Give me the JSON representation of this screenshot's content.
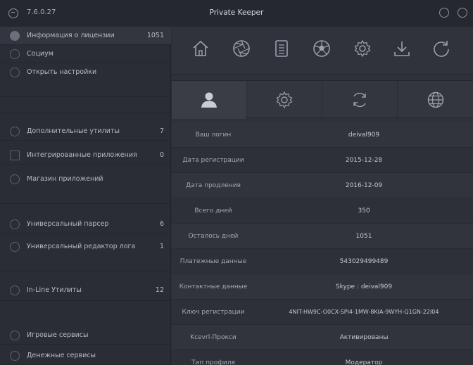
{
  "window": {
    "version": "7.6.0.27",
    "title": "Private Keeper"
  },
  "sidebar": {
    "items": [
      {
        "label": "Информация о лицензии",
        "count": "1051"
      },
      {
        "label": "Социум",
        "count": ""
      },
      {
        "label": "Открыть настройки",
        "count": ""
      },
      {
        "label": "Дополнительные утилиты",
        "count": "7"
      },
      {
        "label": "Интегрированные приложения",
        "count": "0"
      },
      {
        "label": "Магазин приложений",
        "count": ""
      },
      {
        "label": "Универсальный парсер",
        "count": "6"
      },
      {
        "label": "Универсальный редактор лога",
        "count": "1"
      },
      {
        "label": "In-Line Утилиты",
        "count": "12"
      },
      {
        "label": "Игровые сервисы",
        "count": ""
      },
      {
        "label": "Денежные сервисы",
        "count": ""
      }
    ]
  },
  "toolbar": {
    "icons": [
      "home-icon",
      "aperture-icon",
      "notebook-icon",
      "ball-icon",
      "gear-icon",
      "download-icon",
      "refresh-icon"
    ]
  },
  "tabs": {
    "icons": [
      "user-icon",
      "gear-icon",
      "sync-icon",
      "globe-icon"
    ]
  },
  "info": {
    "rows": [
      {
        "key": "Ваш логин",
        "value": "deival909"
      },
      {
        "key": "Дата регистрации",
        "value": "2015-12-28"
      },
      {
        "key": "Дата продления",
        "value": "2016-12-09"
      },
      {
        "key": "Всего дней",
        "value": "350"
      },
      {
        "key": "Осталось дней",
        "value": "1051"
      },
      {
        "key": "Платежные данные",
        "value": "543029499489"
      },
      {
        "key": "Контактные данные",
        "value": "Skype : deival909"
      },
      {
        "key": "Ключ регистрации",
        "value": "4NIT-HW9C-O0CX-SPI4-1MW-8KIA-9WYH-Q1GN-22I04"
      },
      {
        "key": "Kcevrl-Прокси",
        "value": "Активированы"
      },
      {
        "key": "Тип профиля",
        "value": "Модератор"
      }
    ]
  },
  "colors": {
    "background": "#2b2e36",
    "sidebar": "#2a2d35",
    "titlebar": "#25282f",
    "icon": "#8d919a",
    "text": "#c7cad1"
  }
}
